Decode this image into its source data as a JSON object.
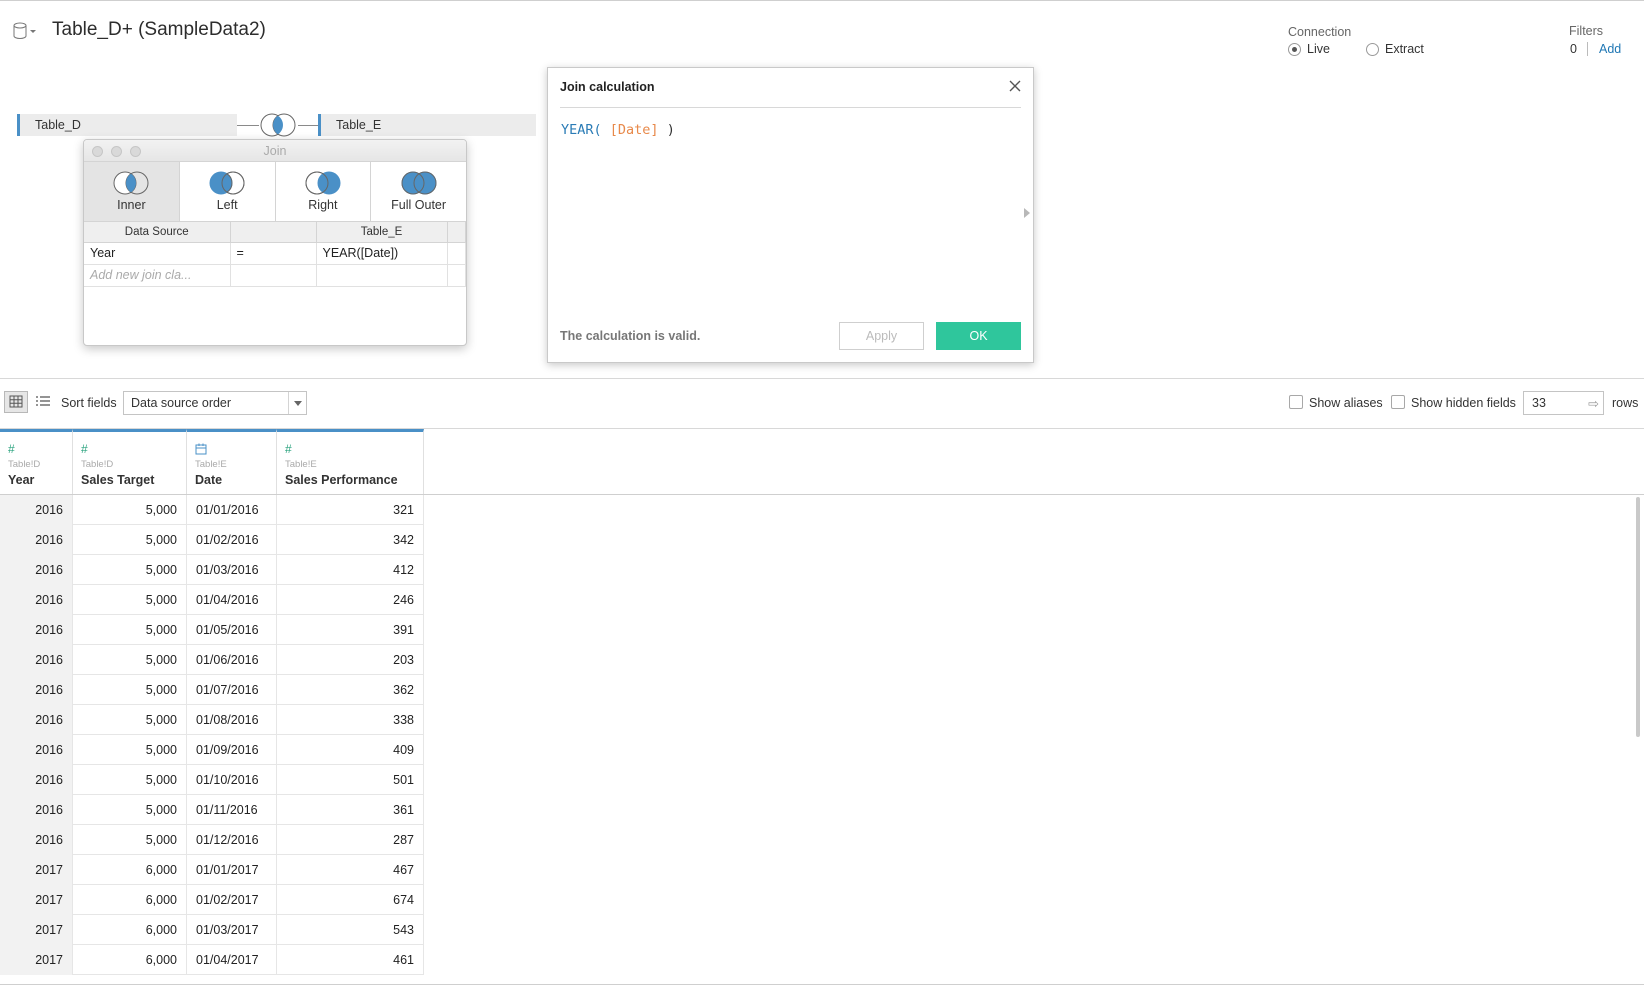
{
  "header": {
    "title": "Table_D+ (SampleData2)",
    "connection_label": "Connection",
    "connection_options": [
      {
        "label": "Live",
        "selected": true
      },
      {
        "label": "Extract",
        "selected": false
      }
    ],
    "filters_label": "Filters",
    "filters_count": "0",
    "filters_add": "Add"
  },
  "join_canvas": {
    "left_table": "Table_D",
    "right_table": "Table_E"
  },
  "join_popup": {
    "title": "Join",
    "types": [
      {
        "label": "Inner",
        "selected": true
      },
      {
        "label": "Left",
        "selected": false
      },
      {
        "label": "Right",
        "selected": false
      },
      {
        "label": "Full Outer",
        "selected": false
      }
    ],
    "left_header": "Data Source",
    "right_header": "Table_E",
    "clauses": [
      {
        "left": "Year",
        "op": "=",
        "right": "YEAR([Date])"
      }
    ],
    "add_placeholder": "Add new join cla..."
  },
  "calc_dialog": {
    "title": "Join calculation",
    "code_fn": "YEAR(",
    "code_field": "[Date]",
    "code_close": ")",
    "status": "The calculation is valid.",
    "apply_label": "Apply",
    "ok_label": "OK",
    "ok_color": "#2fc69c"
  },
  "toolbar": {
    "sort_label": "Sort fields",
    "sort_value": "Data source order",
    "show_aliases": "Show aliases",
    "show_hidden": "Show hidden fields",
    "rows_value": "33",
    "rows_label": "rows"
  },
  "grid": {
    "columns": [
      {
        "icon": "#",
        "source": "Table!D",
        "name": "Year"
      },
      {
        "icon": "#",
        "source": "Table!D",
        "name": "Sales Target"
      },
      {
        "icon": "date",
        "source": "Table!E",
        "name": "Date"
      },
      {
        "icon": "#",
        "source": "Table!E",
        "name": "Sales Performance"
      }
    ],
    "rows": [
      [
        "2016",
        "5,000",
        "01/01/2016",
        "321"
      ],
      [
        "2016",
        "5,000",
        "01/02/2016",
        "342"
      ],
      [
        "2016",
        "5,000",
        "01/03/2016",
        "412"
      ],
      [
        "2016",
        "5,000",
        "01/04/2016",
        "246"
      ],
      [
        "2016",
        "5,000",
        "01/05/2016",
        "391"
      ],
      [
        "2016",
        "5,000",
        "01/06/2016",
        "203"
      ],
      [
        "2016",
        "5,000",
        "01/07/2016",
        "362"
      ],
      [
        "2016",
        "5,000",
        "01/08/2016",
        "338"
      ],
      [
        "2016",
        "5,000",
        "01/09/2016",
        "409"
      ],
      [
        "2016",
        "5,000",
        "01/10/2016",
        "501"
      ],
      [
        "2016",
        "5,000",
        "01/11/2016",
        "361"
      ],
      [
        "2016",
        "5,000",
        "01/12/2016",
        "287"
      ],
      [
        "2017",
        "6,000",
        "01/01/2017",
        "467"
      ],
      [
        "2017",
        "6,000",
        "01/02/2017",
        "674"
      ],
      [
        "2017",
        "6,000",
        "01/03/2017",
        "543"
      ],
      [
        "2017",
        "6,000",
        "01/04/2017",
        "461"
      ]
    ],
    "accent": "#4a90c7"
  }
}
